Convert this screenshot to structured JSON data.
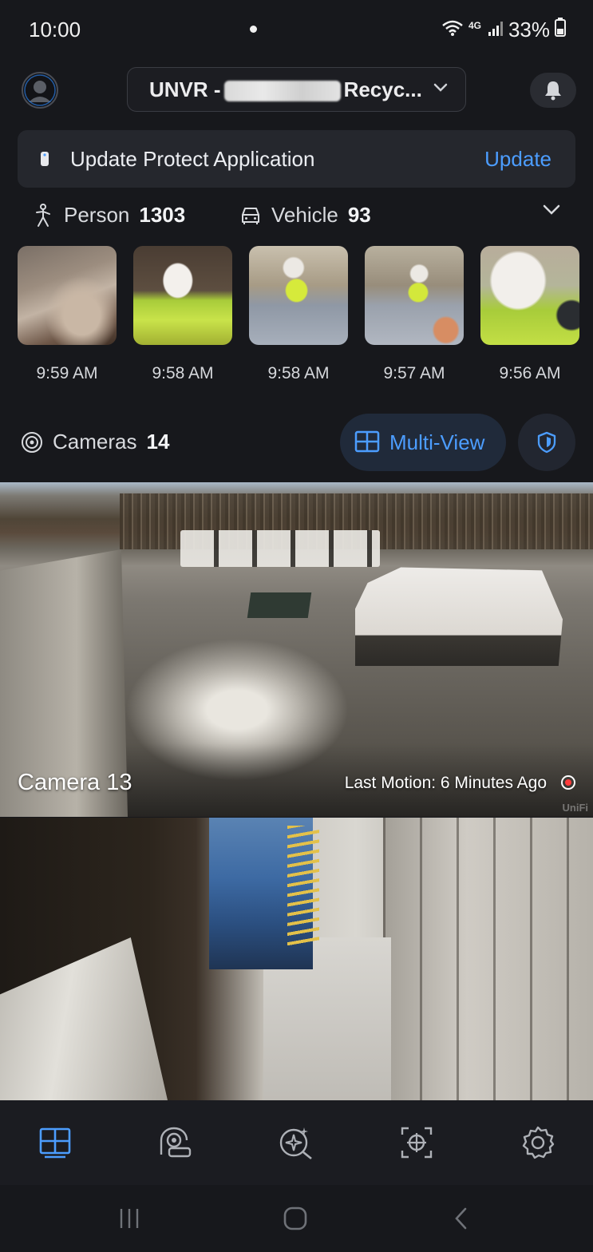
{
  "status_bar": {
    "time": "10:00",
    "network": "4G",
    "battery": "33%"
  },
  "header": {
    "site_prefix": "UNVR -",
    "site_suffix": "Recyc..."
  },
  "banner": {
    "message": "Update Protect Application",
    "action": "Update"
  },
  "detections": {
    "person_label": "Person",
    "person_count": "1303",
    "vehicle_label": "Vehicle",
    "vehicle_count": "93"
  },
  "events": [
    {
      "time": "9:59 AM"
    },
    {
      "time": "9:58 AM"
    },
    {
      "time": "9:58 AM"
    },
    {
      "time": "9:57 AM"
    },
    {
      "time": "9:56 AM"
    }
  ],
  "cameras": {
    "label": "Cameras",
    "count": "14",
    "multiview_label": "Multi-View"
  },
  "feeds": [
    {
      "name": "Camera 13",
      "motion": "Last Motion: 6 Minutes Ago",
      "watermark": "UniFi"
    }
  ],
  "colors": {
    "accent": "#4c9dff",
    "background": "#17181c",
    "recording": "#ff3b3b"
  },
  "nav": {
    "icons": [
      "multiview-icon",
      "cameras-icon",
      "detections-icon",
      "alarm-manager-icon",
      "settings-icon"
    ],
    "active_index": 0
  }
}
